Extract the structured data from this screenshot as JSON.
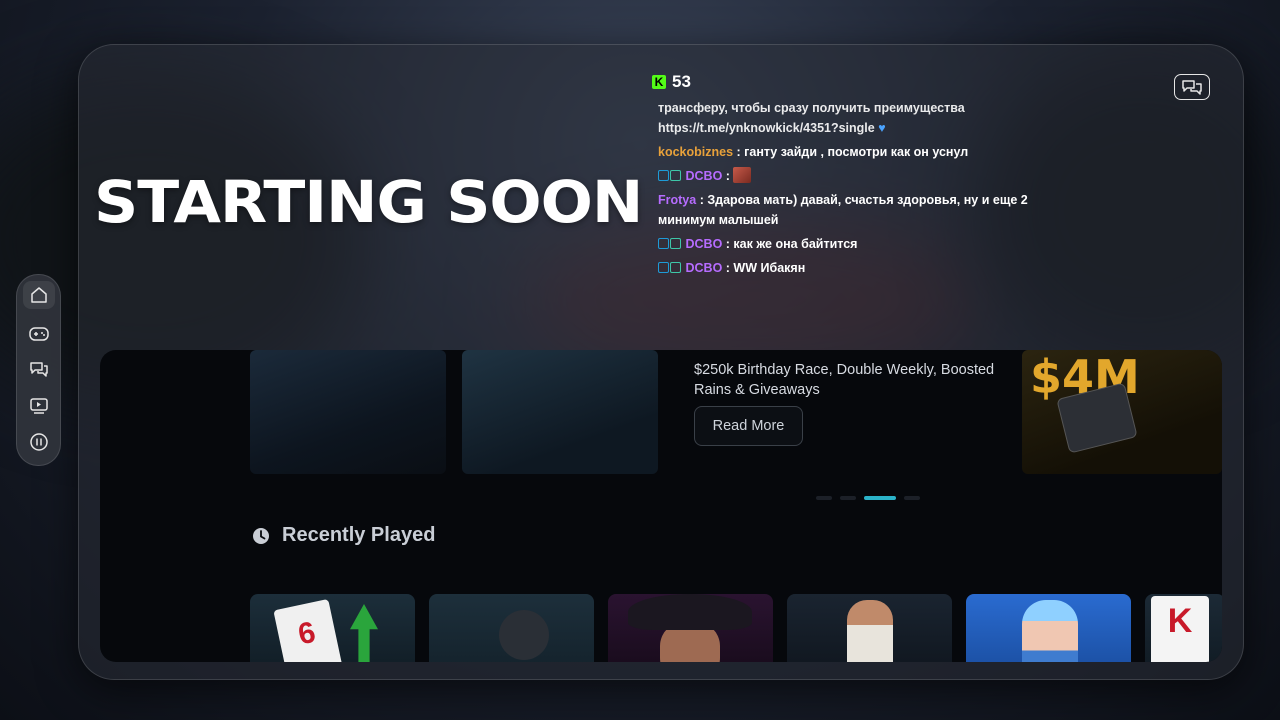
{
  "stream": {
    "headline": "STARTING SOON",
    "viewer_count": "53",
    "platform_logo_letter": "K"
  },
  "chat": {
    "messages": [
      {
        "user": "",
        "text": "трансферу, чтобы сразу получить преимущества https://t.me/ynknowkick/4351?single",
        "suffix_icon": "blue-heart",
        "user_color": ""
      },
      {
        "user": "kockobiznes",
        "text": "ганту зайди , посмотри как он уснул",
        "user_color": "#e8a13a",
        "badges": []
      },
      {
        "user": "DCBO",
        "text": "",
        "user_color": "#b66cff",
        "badges": [
          "badge-a",
          "badge-b"
        ],
        "emote": true
      },
      {
        "user": "Frotya",
        "text": "Здарова мать) давай, счастья здоровья, ну и еще 2 минимум малышей",
        "user_color": "#b66cff",
        "badges": []
      },
      {
        "user": "DCBO",
        "text": "как же она байтится",
        "user_color": "#b66cff",
        "badges": [
          "badge-a",
          "badge-b"
        ]
      },
      {
        "user": "DCBO",
        "text": "WW Ибакян",
        "user_color": "#b66cff",
        "badges": [
          "badge-a",
          "badge-b"
        ]
      }
    ]
  },
  "site": {
    "promo_text": "$250k Birthday Race, Double Weekly, Boosted Rains & Giveaways",
    "read_more_label": "Read More",
    "banner_gold_text": "$4M",
    "section_title": "Recently Played",
    "games": [
      {
        "name": "card-arrow-game",
        "glyph": "6"
      },
      {
        "name": "bomb-game",
        "glyph": ""
      },
      {
        "name": "gangster-game",
        "glyph": ""
      },
      {
        "name": "dealer-game",
        "glyph": ""
      },
      {
        "name": "ice-queen-game",
        "glyph": ""
      },
      {
        "name": "king-card-game",
        "glyph": "K"
      }
    ],
    "carousel": {
      "count": 4,
      "active_index": 2
    }
  },
  "colors": {
    "kick_green": "#53fc18",
    "accent_cyan": "#2bb3c9",
    "username_purple": "#b66cff",
    "username_orange": "#e8a13a"
  }
}
